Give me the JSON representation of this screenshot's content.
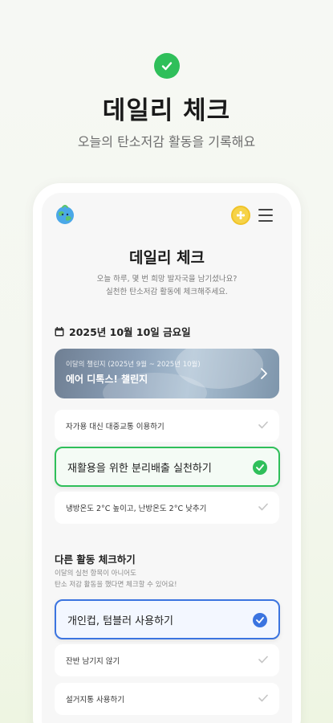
{
  "hero": {
    "title": "데일리 체크",
    "subtitle": "오늘의 탄소저감 활동을 기록해요"
  },
  "screen": {
    "title": "데일리 체크",
    "desc_line1": "오늘 하루, 몇 번 희망 발자국을 남기셨나요?",
    "desc_line2": "실천한 탄소저감 활동에 체크해주세요.",
    "date": "2025년 10월 10일 금요일",
    "challenge": {
      "period": "이달의 챌린지 (2025년 9월 ~ 2025년 10월)",
      "name": "에어 디톡스! 챌린지"
    },
    "items": [
      {
        "label": "자가용 대신 대중교통 이용하기",
        "checked": false
      },
      {
        "label": "재활용을 위한 분리배출 실천하기",
        "checked": true
      },
      {
        "label": "냉방온도 2°C 높이고, 난방온도 2°C 낮추기",
        "checked": false
      }
    ],
    "other": {
      "title": "다른 활동 체크하기",
      "desc_line1": "이달의 실천 항목이 아니어도",
      "desc_line2": "탄소 저감 활동을 했다면 체크할 수 있어요!",
      "items": [
        {
          "label": "개인컵, 텀블러 사용하기",
          "checked": true
        },
        {
          "label": "잔반 남기지 않기",
          "checked": false
        },
        {
          "label": "설거지통 사용하기",
          "checked": false
        }
      ]
    }
  },
  "colors": {
    "green": "#2fbf5a",
    "blue": "#3b74e0"
  }
}
